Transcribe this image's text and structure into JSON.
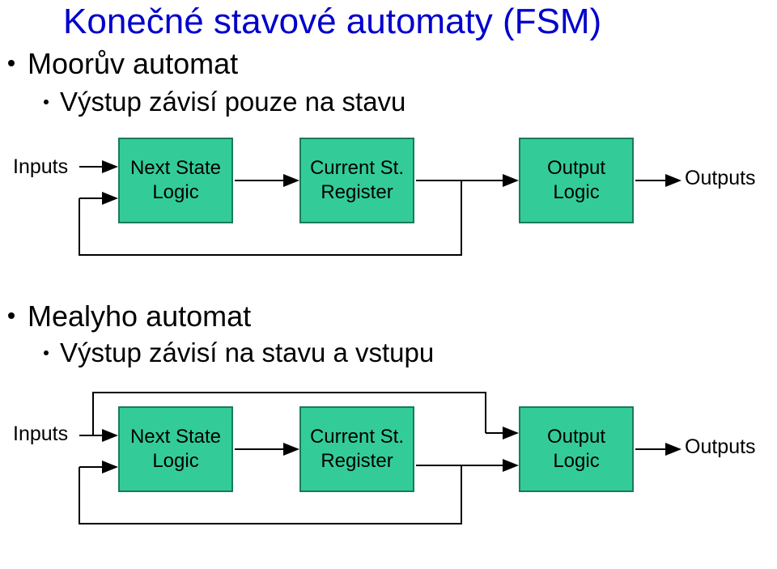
{
  "title": "Konečné stavové automaty (FSM)",
  "moor": {
    "name": "Moorův automat",
    "desc": "Výstup závisí pouze na stavu",
    "inputs": "Inputs",
    "outputs": "Outputs",
    "box1_l1": "Next State",
    "box1_l2": "Logic",
    "box2_l1": "Current St.",
    "box2_l2": "Register",
    "box3_l1": "Output",
    "box3_l2": "Logic"
  },
  "mealy": {
    "name": "Mealyho automat",
    "desc": "Výstup závisí na stavu a vstupu",
    "inputs": "Inputs",
    "outputs": "Outputs",
    "box1_l1": "Next State",
    "box1_l2": "Logic",
    "box2_l1": "Current St.",
    "box2_l2": "Register",
    "box3_l1": "Output",
    "box3_l2": "Logic"
  }
}
